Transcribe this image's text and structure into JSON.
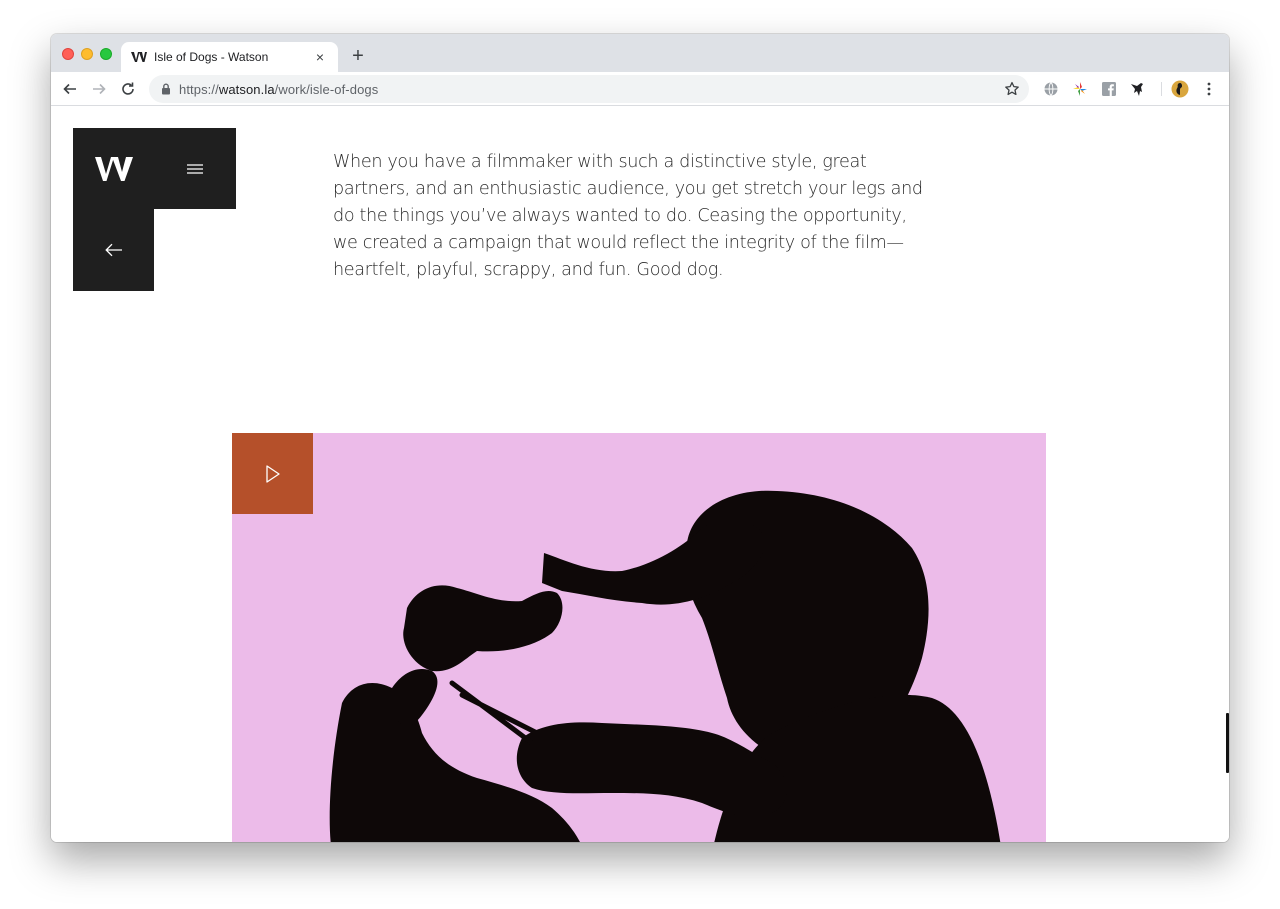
{
  "browser": {
    "tab_title": "Isle of Dogs - Watson",
    "tab_favicon": "watson-w-icon",
    "close_glyph": "×",
    "new_tab_glyph": "+",
    "url_scheme": "https://",
    "url_host": "watson.la",
    "url_path": "/work/isle-of-dogs",
    "extensions": [
      "globe-icon",
      "color-wheel-icon",
      "facebook-icon",
      "bird-icon"
    ],
    "profile": "avatar"
  },
  "page": {
    "logo_icon": "watson-w-logo",
    "menu_icon": "hamburger-icon",
    "back_icon": "arrow-left-icon",
    "intro_text": "When you have a filmmaker with such a distinctive style, great partners, and an enthusiastic audience, you get stretch your legs and do the things you’ve always wanted to do. Ceasing the opportunity, we created a campaign that would reflect the integrity of the film—heartfelt, playful, scrappy, and fun. Good dog.",
    "video": {
      "play_icon": "play-icon",
      "background_color": "#ecbbe9",
      "play_button_color": "#b5502a"
    }
  },
  "colors": {
    "nav_block": "#1f1f1f",
    "accent": "#b5502a",
    "text": "#2a2a2a"
  }
}
